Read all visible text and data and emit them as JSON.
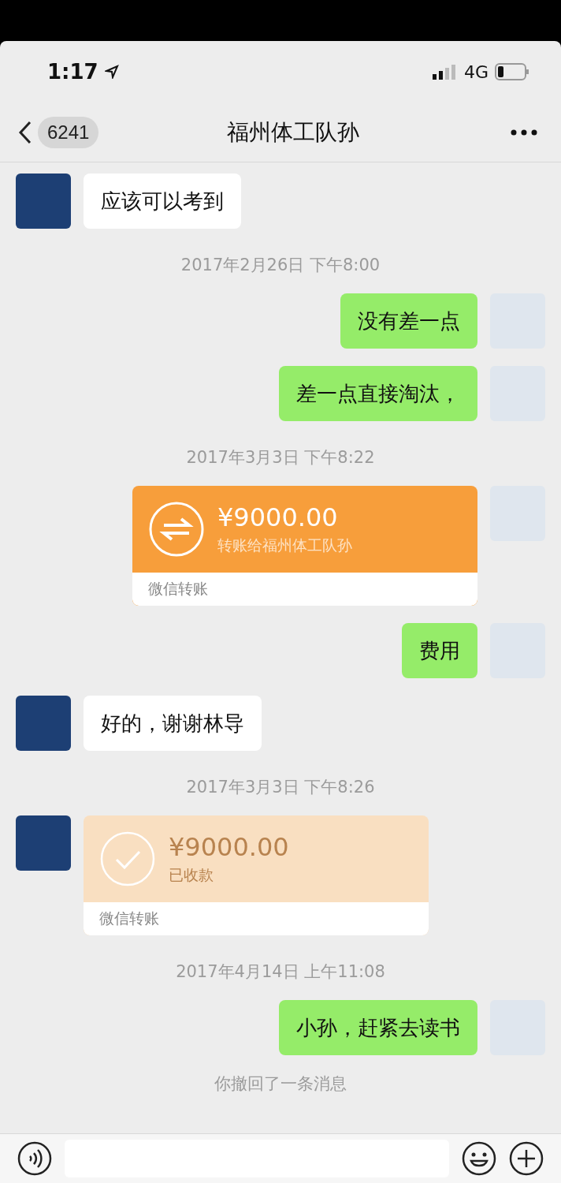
{
  "status_bar": {
    "time": "1:17",
    "network": "4G"
  },
  "nav": {
    "back_count": "6241",
    "title": "福州体工队孙"
  },
  "messages": [
    {
      "kind": "text",
      "outgoing": false,
      "text": "应该可以考到"
    },
    {
      "kind": "time",
      "text": "2017年2月26日 下午8:00"
    },
    {
      "kind": "text",
      "outgoing": true,
      "text": "没有差一点"
    },
    {
      "kind": "text",
      "outgoing": true,
      "text": "差一点直接淘汰，"
    },
    {
      "kind": "time",
      "text": "2017年3月3日 下午8:22"
    },
    {
      "kind": "transfer",
      "outgoing": true,
      "received": false,
      "amount": "¥9000.00",
      "note": "转账给福州体工队孙",
      "footer": "微信转账"
    },
    {
      "kind": "text",
      "outgoing": true,
      "text": "费用"
    },
    {
      "kind": "text",
      "outgoing": false,
      "text": "好的，谢谢林导"
    },
    {
      "kind": "time",
      "text": "2017年3月3日 下午8:26"
    },
    {
      "kind": "transfer",
      "outgoing": false,
      "received": true,
      "amount": "¥9000.00",
      "note": "已收款",
      "footer": "微信转账"
    },
    {
      "kind": "time",
      "text": "2017年4月14日 上午11:08"
    },
    {
      "kind": "text",
      "outgoing": true,
      "text": "小孙，赶紧去读书"
    },
    {
      "kind": "recall",
      "text": "你撤回了一条消息"
    }
  ]
}
